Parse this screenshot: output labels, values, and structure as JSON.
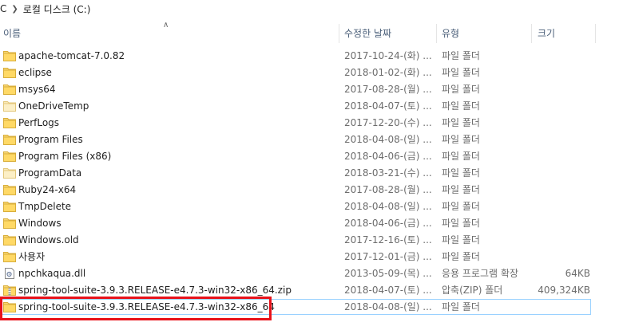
{
  "breadcrumb": {
    "prefix": "C",
    "sep_icon": "chevron-right-icon",
    "location": "로컬 디스크 (C:)"
  },
  "columns": {
    "name": "이름",
    "date": "수정한 날짜",
    "type": "유형",
    "size": "크기",
    "sort_icon": "sort-up-caret-icon"
  },
  "colors": {
    "highlight": "#e8121a",
    "selection_border": "#99d1ff",
    "folder": "#f8d775"
  },
  "files": [
    {
      "name": "apache-tomcat-7.0.82",
      "date": "2017-10-24-(화) ...",
      "type": "파일 폴더",
      "size": "",
      "icon": "folder-icon"
    },
    {
      "name": "eclipse",
      "date": "2018-01-02-(화) ...",
      "type": "파일 폴더",
      "size": "",
      "icon": "folder-icon"
    },
    {
      "name": "msys64",
      "date": "2017-08-28-(월) ...",
      "type": "파일 폴더",
      "size": "",
      "icon": "folder-icon"
    },
    {
      "name": "OneDriveTemp",
      "date": "2018-04-07-(토) ...",
      "type": "파일 폴더",
      "size": "",
      "icon": "folder-light-icon"
    },
    {
      "name": "PerfLogs",
      "date": "2017-12-20-(수) ...",
      "type": "파일 폴더",
      "size": "",
      "icon": "folder-icon"
    },
    {
      "name": "Program Files",
      "date": "2018-04-08-(일) ...",
      "type": "파일 폴더",
      "size": "",
      "icon": "folder-icon"
    },
    {
      "name": "Program Files (x86)",
      "date": "2018-04-06-(금) ...",
      "type": "파일 폴더",
      "size": "",
      "icon": "folder-icon"
    },
    {
      "name": "ProgramData",
      "date": "2018-03-21-(수) ...",
      "type": "파일 폴더",
      "size": "",
      "icon": "folder-light-icon"
    },
    {
      "name": "Ruby24-x64",
      "date": "2017-08-28-(월) ...",
      "type": "파일 폴더",
      "size": "",
      "icon": "folder-icon"
    },
    {
      "name": "TmpDelete",
      "date": "2018-04-08-(일) ...",
      "type": "파일 폴더",
      "size": "",
      "icon": "folder-icon"
    },
    {
      "name": "Windows",
      "date": "2018-04-06-(금) ...",
      "type": "파일 폴더",
      "size": "",
      "icon": "folder-icon"
    },
    {
      "name": "Windows.old",
      "date": "2017-12-16-(토) ...",
      "type": "파일 폴더",
      "size": "",
      "icon": "folder-icon"
    },
    {
      "name": "사용자",
      "date": "2017-12-01-(금) ...",
      "type": "파일 폴더",
      "size": "",
      "icon": "folder-icon"
    },
    {
      "name": "npchkaqua.dll",
      "date": "2013-05-09-(목) ...",
      "type": "응용 프로그램 확장",
      "size": "64KB",
      "icon": "dll-file-icon"
    },
    {
      "name": "spring-tool-suite-3.9.3.RELEASE-e4.7.3-win32-x86_64.zip",
      "date": "2018-04-07-(토) ...",
      "type": "압축(ZIP) 폴더",
      "size": "409,324KB",
      "icon": "zip-folder-icon"
    },
    {
      "name": "spring-tool-suite-3.9.3.RELEASE-e4.7.3-win32-x86_64",
      "date": "2018-04-08-(일) ...",
      "type": "파일 폴더",
      "size": "",
      "icon": "folder-icon",
      "selected": true
    }
  ]
}
